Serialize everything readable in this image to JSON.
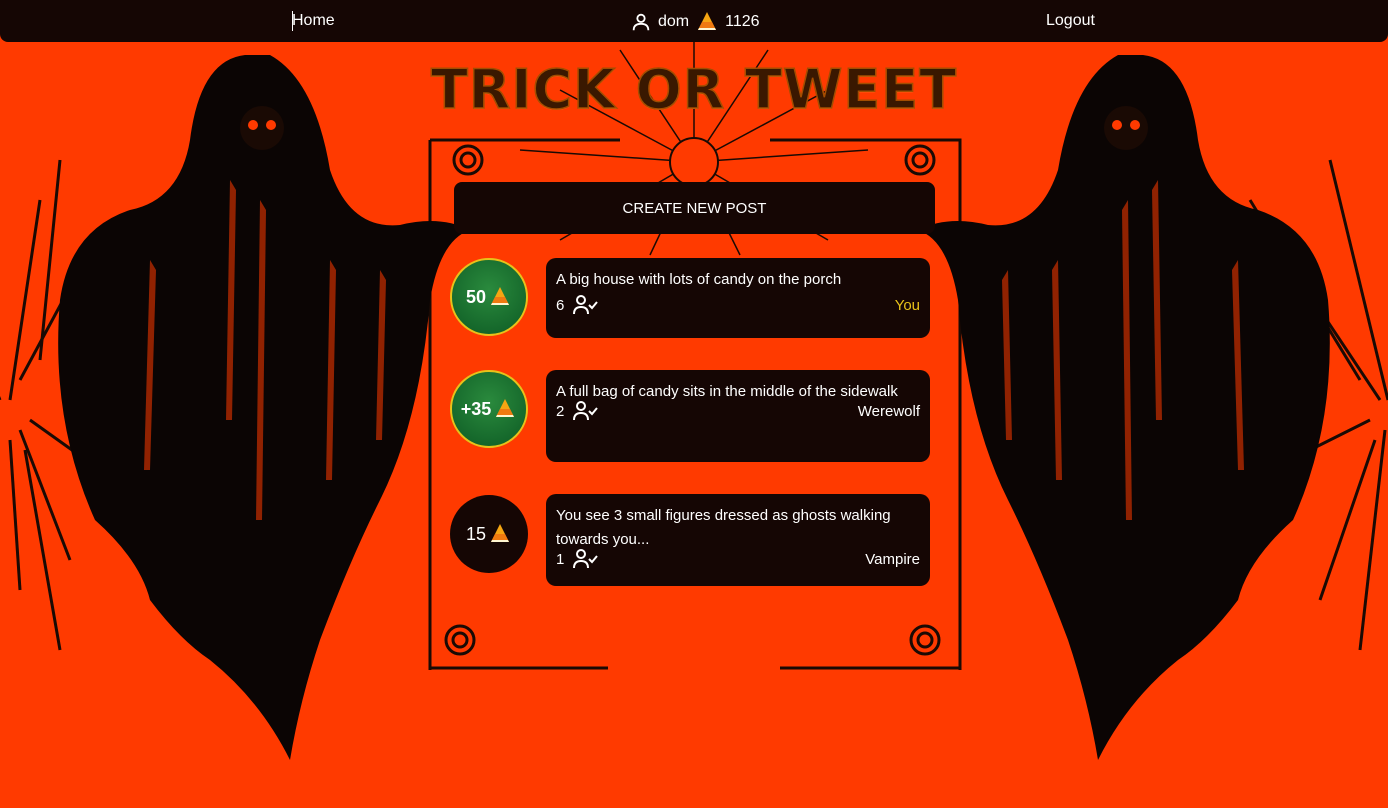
{
  "nav": {
    "home_label": "Home",
    "username": "dom",
    "candy_count": "1126",
    "logout_label": "Logout"
  },
  "title": "TRICK OR TWEET",
  "create_post_label": "CREATE NEW POST",
  "posts": [
    {
      "badge": "50",
      "badge_style": "green",
      "text": "A big house with lots of candy on the porch",
      "count": "6",
      "author": "You",
      "author_is_you": true
    },
    {
      "badge": "+35",
      "badge_style": "green",
      "text": "A full bag of candy sits in the middle of the sidewalk",
      "count": "2",
      "author": "Werewolf",
      "author_is_you": false
    },
    {
      "badge": "15",
      "badge_style": "dark",
      "text": "You see 3 small figures dressed as ghosts walking towards you...",
      "count": "1",
      "author": "Vampire",
      "author_is_you": false
    }
  ],
  "colors": {
    "background": "#ff3a00",
    "panel": "#150604",
    "accent_gold": "#e8c21a",
    "badge_green": "#1d7a33"
  },
  "icons": {
    "user": "user-icon",
    "candy": "candy-corn-icon",
    "followers": "user-check-icon"
  }
}
